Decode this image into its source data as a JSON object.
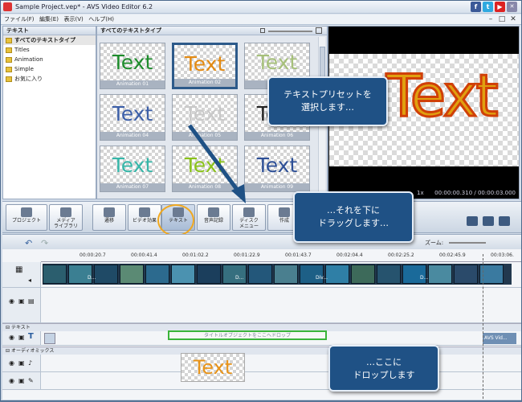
{
  "window": {
    "title": "Sample Project.vep* - AVS Video Editor 6.2"
  },
  "menu": [
    "ファイル(F)",
    "編集(E)",
    "表示(V)",
    "ヘルプ(H)"
  ],
  "left_panel": {
    "header": "テキスト",
    "items": [
      {
        "label": "すべてのテキストタイプ",
        "selected": true
      },
      {
        "label": "Titles"
      },
      {
        "label": "Animation"
      },
      {
        "label": "Simple"
      },
      {
        "label": "お気に入り"
      }
    ]
  },
  "grid": {
    "header": "すべてのテキストタイプ",
    "thumbs": [
      {
        "text": "Text",
        "caption": "Animation 01",
        "color": "#1e8c2c"
      },
      {
        "text": "Text",
        "caption": "Animation 02",
        "color": "#e38a12"
      },
      {
        "text": "Text",
        "caption": "",
        "color": "#a6c07a"
      },
      {
        "text": "Text",
        "caption": "Animation 04",
        "color": "#3c5fa8"
      },
      {
        "text": "Text",
        "caption": "Animation 05",
        "color": "#c8c8c8"
      },
      {
        "text": "Text",
        "caption": "Animation 06",
        "color": "#222222"
      },
      {
        "text": "Text",
        "caption": "Animation 07",
        "color": "#36b6a8"
      },
      {
        "text": "Text",
        "caption": "Animation 08",
        "color": "#8ac21a"
      },
      {
        "text": "Text",
        "caption": "Animation 09",
        "color": "#2d4f96"
      }
    ]
  },
  "preview": {
    "text": "Text",
    "speed": "1x",
    "timecode": "00:00:00.310 / 00:00:03.000"
  },
  "toolbar": {
    "buttons": [
      "プロジェクト",
      "メディア\nライブラリ",
      "遷移",
      "ビデオ効果",
      "テキスト",
      "音声記録",
      "ディスク\nメニュー",
      "作成"
    ]
  },
  "timeline": {
    "zoom_label": "ズーム:",
    "ruler": [
      "00:00:20.7",
      "00:00:41.4",
      "00:01:02.2",
      "00:01:22.9",
      "00:01:43.7",
      "00:02:04.4",
      "00:02:25.2",
      "00:02:45.9",
      "00:03:06."
    ],
    "text_section": "テキスト",
    "audio_section": "オーディオミックス",
    "dropzone": "タイトルオブジェクトをここへドロップ",
    "end_clip": "AVS Vid...",
    "clip_labels": [
      "D...",
      "D...",
      "Div...",
      "D..."
    ]
  },
  "callouts": {
    "c1": "テキストプリセットを\n選択します…",
    "c2": "…それを下に\nドラッグします…",
    "c3": "…ここに\nドロップします"
  },
  "drag_text": "Text"
}
